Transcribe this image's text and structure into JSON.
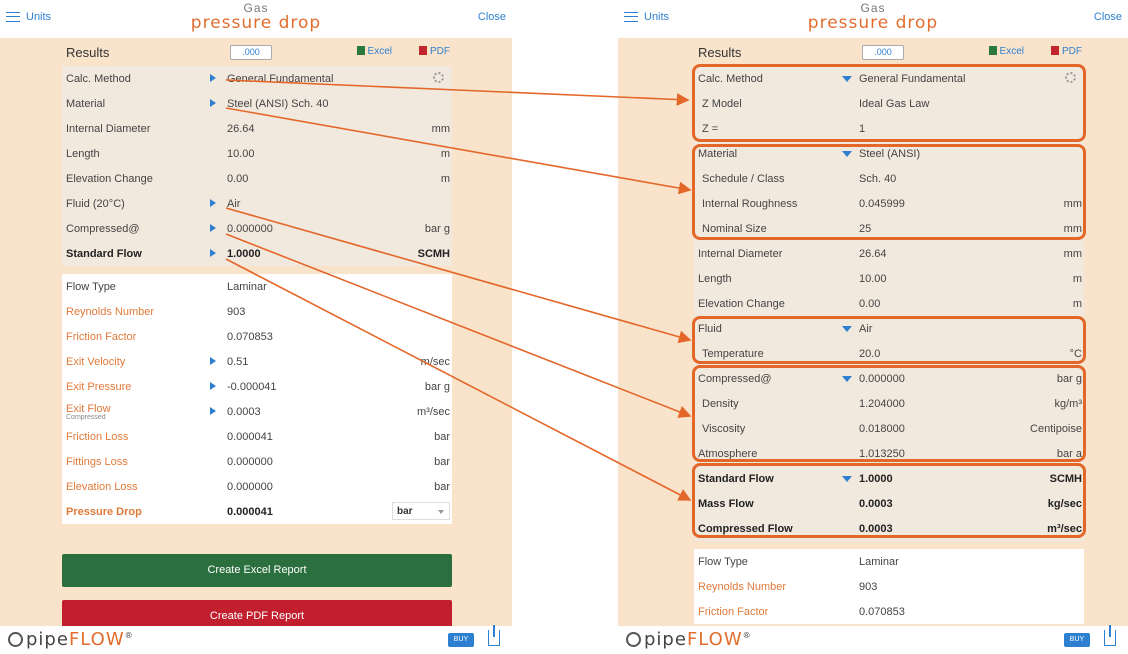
{
  "common": {
    "units_label": "Units",
    "close_label": "Close",
    "logo_top": "Gas",
    "logo_bottom": "pressure drop",
    "results_label": "Results",
    "decimals_value": ".000",
    "excel_label": "Excel",
    "pdf_label": "PDF",
    "brand_pipe": "pipe",
    "brand_flow": "FLOW",
    "brand_reg": "®",
    "buy_label": "BUY"
  },
  "left": {
    "inputs": [
      {
        "label": "Calc. Method",
        "value": "General Fundamental",
        "unit": "",
        "arrow": true
      },
      {
        "label": "Material",
        "value": "Steel (ANSI) Sch.  40",
        "unit": "",
        "arrow": true
      },
      {
        "label": "Internal Diameter",
        "value": "26.64",
        "unit": "mm",
        "arrow": false
      },
      {
        "label": "Length",
        "value": "10.00",
        "unit": "m",
        "arrow": false
      },
      {
        "label": "Elevation Change",
        "value": "0.00",
        "unit": "m",
        "arrow": false
      },
      {
        "label": "Fluid (20°C)",
        "value": "Air",
        "unit": "",
        "arrow": true
      },
      {
        "label": "Compressed@",
        "value": "0.000000",
        "unit": "bar g",
        "arrow": true
      },
      {
        "label": "Standard Flow",
        "value": "1.0000",
        "unit": "SCMH",
        "arrow": true
      }
    ],
    "outputs": [
      {
        "label": "Flow Type",
        "value": "Laminar",
        "unit": ""
      },
      {
        "label": "Reynolds Number",
        "value": "903",
        "unit": ""
      },
      {
        "label": "Friction Factor",
        "value": "0.070853",
        "unit": ""
      },
      {
        "label": "Exit Velocity",
        "value": "0.51",
        "unit": "m/sec"
      },
      {
        "label": "Exit Pressure",
        "value": "-0.000041",
        "unit": "bar g"
      },
      {
        "label": "Exit Flow",
        "sublabel": "Compressed",
        "value": "0.0003",
        "unit": "m³/sec"
      },
      {
        "label": "Friction Loss",
        "value": "0.000041",
        "unit": "bar"
      },
      {
        "label": "Fittings Loss",
        "value": "0.000000",
        "unit": "bar"
      },
      {
        "label": "Elevation Loss",
        "value": "0.000000",
        "unit": "bar"
      }
    ],
    "pressure_drop": {
      "label": "Pressure Drop",
      "value": "0.000041",
      "unit": "bar"
    },
    "create_excel": "Create Excel Report",
    "create_pdf": "Create PDF Report"
  },
  "right": {
    "method_group": [
      {
        "label": "Calc. Method",
        "value": "General Fundamental",
        "unit": ""
      },
      {
        "label": "Z Model",
        "value": "Ideal Gas Law",
        "unit": ""
      },
      {
        "label": "Z =",
        "value": "1",
        "unit": ""
      }
    ],
    "material_group": [
      {
        "label": "Material",
        "value": "Steel (ANSI)",
        "unit": ""
      },
      {
        "label": "Schedule / Class",
        "value": "Sch. 40",
        "unit": ""
      },
      {
        "label": "Internal Roughness",
        "value": "0.045999",
        "unit": "mm"
      },
      {
        "label": "Nominal Size",
        "value": "25",
        "unit": "mm"
      }
    ],
    "dims": [
      {
        "label": "Internal Diameter",
        "value": "26.64",
        "unit": "mm"
      },
      {
        "label": "Length",
        "value": "10.00",
        "unit": "m"
      },
      {
        "label": "Elevation Change",
        "value": "0.00",
        "unit": "m"
      }
    ],
    "fluid_group": [
      {
        "label": "Fluid",
        "value": "Air",
        "unit": ""
      },
      {
        "label": "Temperature",
        "value": "20.0",
        "unit": "°C"
      }
    ],
    "compressed_group": [
      {
        "label": "Compressed@",
        "value": "0.000000",
        "unit": "bar g"
      },
      {
        "label": "Density",
        "value": "1.204000",
        "unit": "kg/m³"
      },
      {
        "label": "Viscosity",
        "value": "0.018000",
        "unit": "Centipoise"
      },
      {
        "label": "Atmosphere",
        "value": "1.013250",
        "unit": "bar a"
      }
    ],
    "flow_group": [
      {
        "label": "Standard Flow",
        "value": "1.0000",
        "unit": "SCMH"
      },
      {
        "label": "Mass Flow",
        "value": "0.0003",
        "unit": "kg/sec"
      },
      {
        "label": "Compressed Flow",
        "value": "0.0003",
        "unit": "m³/sec"
      }
    ],
    "outputs": [
      {
        "label": "Flow Type",
        "value": "Laminar"
      },
      {
        "label": "Reynolds Number",
        "value": "903"
      },
      {
        "label": "Friction Factor",
        "value": "0.070853"
      }
    ]
  },
  "colors": {
    "accent": "#e4672a",
    "link": "#2f7fd0",
    "background": "#f9e3cb",
    "excel_green": "#2b6f3e",
    "pdf_red": "#c11f2e"
  }
}
